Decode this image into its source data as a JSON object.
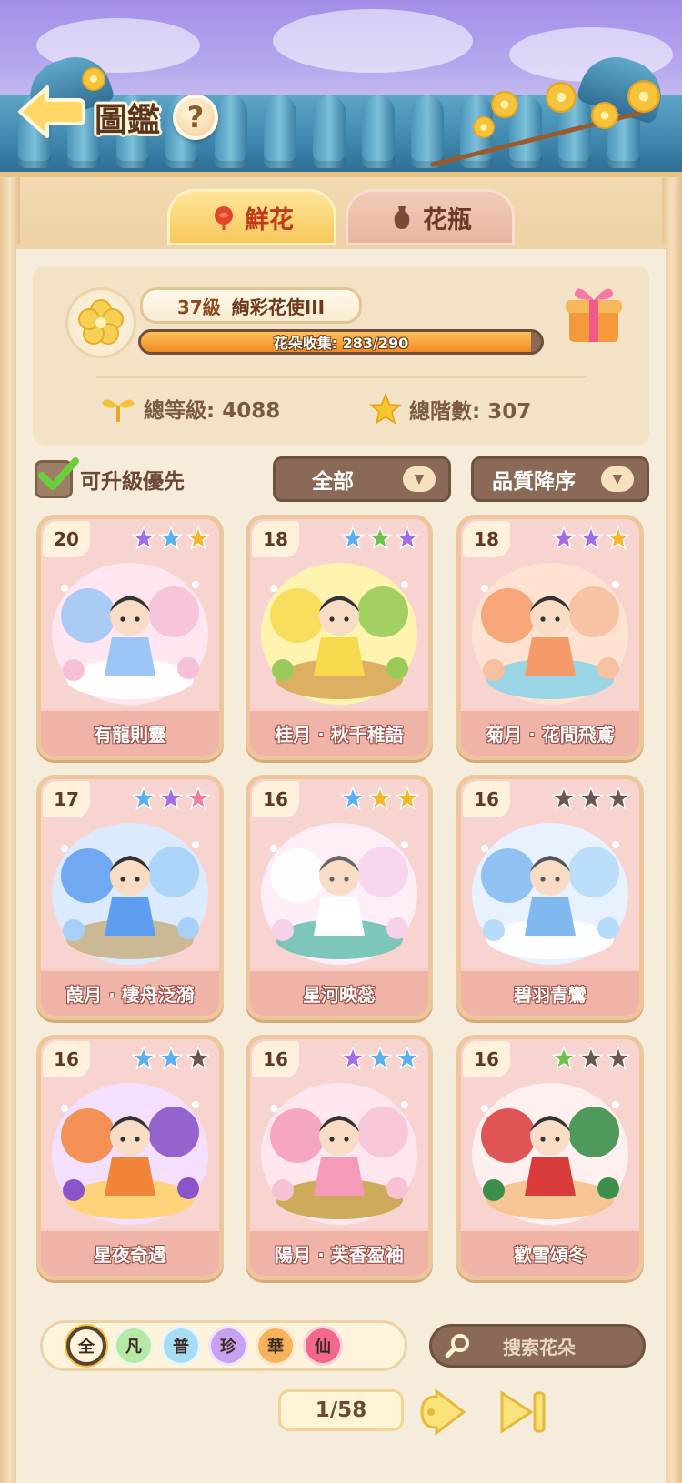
{
  "header": {
    "title": "圖鑑",
    "help": "?"
  },
  "tabs": [
    {
      "label": "鮮花",
      "active": true
    },
    {
      "label": "花瓶",
      "active": false
    }
  ],
  "profile": {
    "level": "37級",
    "rank_title": "絢彩花使III",
    "collection_label": "花朵收集: 283/290",
    "collection_progress": 0.9759,
    "total_level": "總等級: 4088",
    "total_stars": "總階數: 307"
  },
  "filters": {
    "upgrade_first_label": "可升級優先",
    "upgrade_first_checked": true,
    "category": "全部",
    "sort": "品質降序"
  },
  "cards": [
    {
      "level": "20",
      "name": "有龍則靈",
      "stars": [
        "#a56be6",
        "#5ab0f0",
        "#f5b628"
      ],
      "art": "dragon"
    },
    {
      "level": "18",
      "name": "桂月 · 秋千稚語",
      "stars": [
        "#5ab0f0",
        "#6cc24a",
        "#a56be6"
      ],
      "art": "swing"
    },
    {
      "level": "18",
      "name": "菊月 · 花間飛鳶",
      "stars": [
        "#a56be6",
        "#a56be6",
        "#f5b628"
      ],
      "art": "kite"
    },
    {
      "level": "17",
      "name": "葭月 · 棲舟泛漪",
      "stars": [
        "#5ab0f0",
        "#a56be6",
        "#f27ba0"
      ],
      "art": "boat"
    },
    {
      "level": "16",
      "name": "星河映蕊",
      "stars": [
        "#5ab0f0",
        "#f5b628",
        "#f5b628"
      ],
      "art": "roses"
    },
    {
      "level": "16",
      "name": "碧羽青鸞",
      "stars": [
        "#6b5550",
        "#6b5550",
        "#6b5550"
      ],
      "art": "phoenix"
    },
    {
      "level": "16",
      "name": "星夜奇遇",
      "stars": [
        "#5ab0f0",
        "#5ab0f0",
        "#6b5550"
      ],
      "art": "witch"
    },
    {
      "level": "16",
      "name": "陽月 · 芙香盈袖",
      "stars": [
        "#a56be6",
        "#5ab0f0",
        "#5ab0f0"
      ],
      "art": "lotus"
    },
    {
      "level": "16",
      "name": "歡雪頌冬",
      "stars": [
        "#6cc24a",
        "#6b5550",
        "#6b5550"
      ],
      "art": "winter"
    }
  ],
  "rarity_filters": [
    {
      "label": "全",
      "color": "#fff3dc",
      "selected": true
    },
    {
      "label": "凡",
      "color": "#b6e8a8"
    },
    {
      "label": "普",
      "color": "#a8dcf4"
    },
    {
      "label": "珍",
      "color": "#c7a2f0"
    },
    {
      "label": "華",
      "color": "#f7b25a"
    },
    {
      "label": "仙",
      "color": "#f2678a"
    }
  ],
  "search": {
    "placeholder": "搜索花朵"
  },
  "pagination": {
    "current": "1/58"
  },
  "colors": {
    "accent": "#f7c85b",
    "card_bg": "#f7d4cf",
    "card_label": "#f0b3a8",
    "panel": "#f6ecdc"
  }
}
